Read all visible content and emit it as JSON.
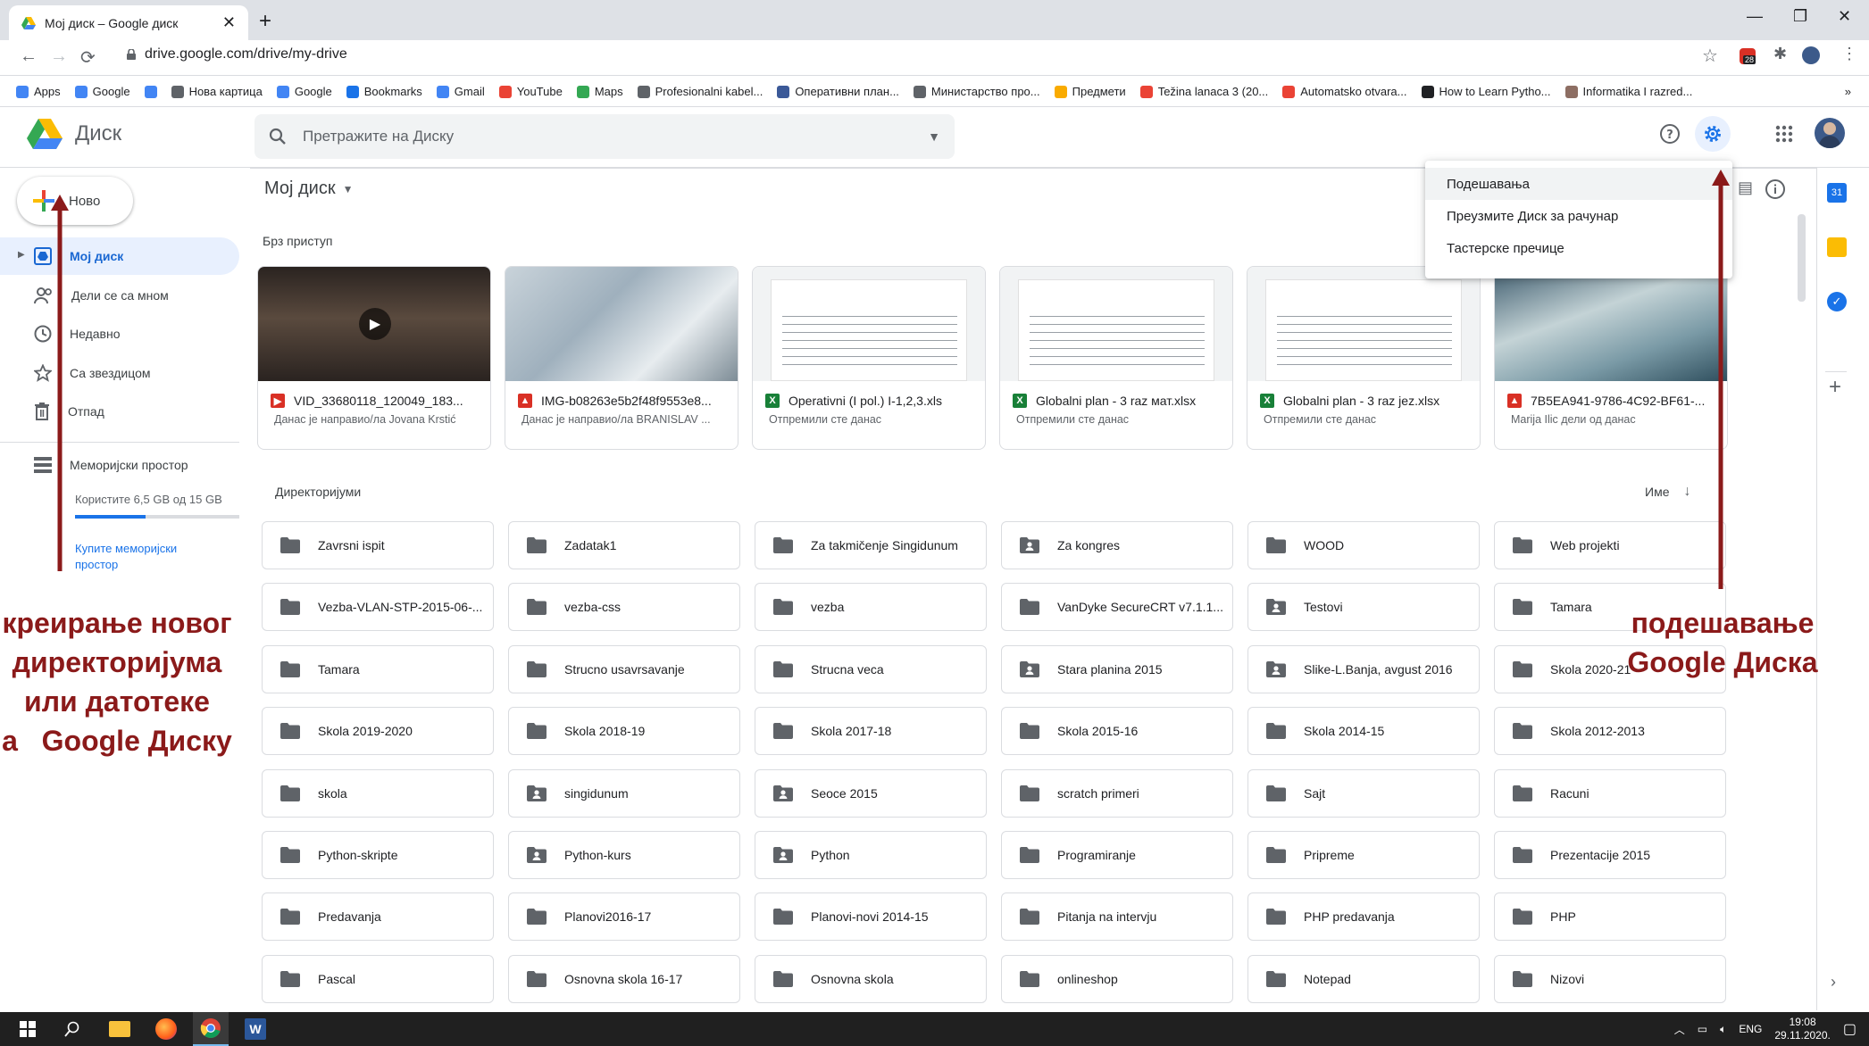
{
  "browser": {
    "tab_title": "Мој диск – Google диск",
    "url": "drive.google.com/drive/my-drive",
    "extension_badge": "28",
    "bookmarks": [
      {
        "label": "Apps",
        "color": "#4285f4"
      },
      {
        "label": "Google",
        "color": "#4285f4"
      },
      {
        "label": "",
        "color": "#4285f4"
      },
      {
        "label": "Нова картица",
        "color": "#5f6368"
      },
      {
        "label": "Google",
        "color": "#4285f4"
      },
      {
        "label": "Bookmarks",
        "color": "#1a73e8"
      },
      {
        "label": "Gmail",
        "color": "#4285f4"
      },
      {
        "label": "YouTube",
        "color": "#ea4335"
      },
      {
        "label": "Maps",
        "color": "#34a853"
      },
      {
        "label": "Profesionalni kabel...",
        "color": "#5f6368"
      },
      {
        "label": "Оперативни план...",
        "color": "#3b5998"
      },
      {
        "label": "Министарство про...",
        "color": "#5f6368"
      },
      {
        "label": "Предмети",
        "color": "#f9ab00"
      },
      {
        "label": "Težina lanaca 3 (20...",
        "color": "#ea4335"
      },
      {
        "label": "Automatsko otvara...",
        "color": "#ea4335"
      },
      {
        "label": "How to Learn Pytho...",
        "color": "#202124"
      },
      {
        "label": "Informatika I razred...",
        "color": "#8d6e63"
      }
    ],
    "bookmarks_overflow": "»"
  },
  "drive": {
    "app_name": "Диск",
    "search_placeholder": "Претражите на Диску",
    "new_label": "Ново",
    "nav": [
      {
        "label": "Мој диск",
        "icon": "my-drive-icon"
      },
      {
        "label": "Дели се са мном",
        "icon": "shared-icon"
      },
      {
        "label": "Недавно",
        "icon": "clock-icon"
      },
      {
        "label": "Са звездицом",
        "icon": "star-icon"
      },
      {
        "label": "Отпад",
        "icon": "trash-icon"
      }
    ],
    "storage_label": "Меморијски простор",
    "storage_used_text": "Користите 6,5 GB од 15 GB",
    "storage_used_fraction": 0.43,
    "buy_storage_label": "Купите меморијски простор",
    "breadcrumb": "Мој диск",
    "quick_access_label": "Брз приступ",
    "quick_access": [
      {
        "name": "VID_33680118_120049_183...",
        "sub": "Данас је направио/ла Jovana Krstić",
        "type": "video",
        "color": "#d93025"
      },
      {
        "name": "IMG-b08263e5b2f48f9553e8...",
        "sub": "Данас је направио/ла BRANISLAV ...",
        "type": "image",
        "color": "#d93025"
      },
      {
        "name": "Operativni (I pol.) I-1,2,3.xls",
        "sub": "Отпремили сте данас",
        "type": "sheet",
        "color": "#188038"
      },
      {
        "name": "Globalni plan - 3 raz мат.xlsx",
        "sub": "Отпремили сте данас",
        "type": "sheet",
        "color": "#188038"
      },
      {
        "name": "Globalni plan - 3 raz jez.xlsx",
        "sub": "Отпремили сте данас",
        "type": "sheet",
        "color": "#188038"
      },
      {
        "name": "7B5EA941-9786-4C92-BF61-...",
        "sub": "Marija Ilic дели од данас",
        "type": "image",
        "color": "#d93025"
      }
    ],
    "folders_label": "Директоријуми",
    "sort_label": "Име",
    "folders": [
      {
        "name": "Zavrsni ispit",
        "shared": false
      },
      {
        "name": "Zadatak1",
        "shared": false
      },
      {
        "name": "Za takmičenje Singidunum",
        "shared": false
      },
      {
        "name": "Za kongres",
        "shared": true
      },
      {
        "name": "WOOD",
        "shared": false
      },
      {
        "name": "Web projekti",
        "shared": false
      },
      {
        "name": "Vezba-VLAN-STP-2015-06-...",
        "shared": false
      },
      {
        "name": "vezba-css",
        "shared": false
      },
      {
        "name": "vezba",
        "shared": false
      },
      {
        "name": "VanDyke SecureCRT v7.1.1...",
        "shared": false
      },
      {
        "name": "Testovi",
        "shared": true
      },
      {
        "name": "Tamara",
        "shared": false
      },
      {
        "name": "Tamara",
        "shared": false
      },
      {
        "name": "Strucno usavrsavanje",
        "shared": false
      },
      {
        "name": "Strucna veca",
        "shared": false
      },
      {
        "name": "Stara planina 2015",
        "shared": true
      },
      {
        "name": "Slike-L.Banja, avgust 2016",
        "shared": true
      },
      {
        "name": "Skola 2020-21",
        "shared": false
      },
      {
        "name": "Skola 2019-2020",
        "shared": false
      },
      {
        "name": "Skola 2018-19",
        "shared": false
      },
      {
        "name": "Skola 2017-18",
        "shared": false
      },
      {
        "name": "Skola 2015-16",
        "shared": false
      },
      {
        "name": "Skola 2014-15",
        "shared": false
      },
      {
        "name": "Skola 2012-2013",
        "shared": false
      },
      {
        "name": "skola",
        "shared": false
      },
      {
        "name": "singidunum",
        "shared": true
      },
      {
        "name": "Seoce 2015",
        "shared": true
      },
      {
        "name": "scratch primeri",
        "shared": false
      },
      {
        "name": "Sajt",
        "shared": false
      },
      {
        "name": "Racuni",
        "shared": false
      },
      {
        "name": "Python-skripte",
        "shared": false
      },
      {
        "name": "Python-kurs",
        "shared": true
      },
      {
        "name": "Python",
        "shared": true
      },
      {
        "name": "Programiranje",
        "shared": false
      },
      {
        "name": "Pripreme",
        "shared": false
      },
      {
        "name": "Prezentacije 2015",
        "shared": false
      },
      {
        "name": "Predavanja",
        "shared": false
      },
      {
        "name": "Planovi2016-17",
        "shared": false
      },
      {
        "name": "Planovi-novi 2014-15",
        "shared": false
      },
      {
        "name": "Pitanja na intervju",
        "shared": false
      },
      {
        "name": "PHP predavanja",
        "shared": false
      },
      {
        "name": "PHP",
        "shared": false
      },
      {
        "name": "Pascal",
        "shared": false
      },
      {
        "name": "Osnovna skola 16-17",
        "shared": false
      },
      {
        "name": "Osnovna skola",
        "shared": false
      },
      {
        "name": "onlineshop",
        "shared": false
      },
      {
        "name": "Notepad",
        "shared": false
      },
      {
        "name": "Nizovi",
        "shared": false
      }
    ],
    "settings_menu": [
      "Подешавања",
      "Преузмите Диск за рачунар",
      "Тастерске пречице"
    ]
  },
  "annotations": {
    "left": [
      "креирање новог",
      "директоријума",
      "или датотеке",
      "а   Google Диску"
    ],
    "right": [
      "подешавање",
      "Google Диска"
    ],
    "color": "#8b1a1a"
  },
  "taskbar": {
    "lang": "ENG",
    "time": "19:08",
    "date": "29.11.2020."
  },
  "colors": {
    "accent": "#1a73e8",
    "folder_icon": "#5f6368"
  }
}
